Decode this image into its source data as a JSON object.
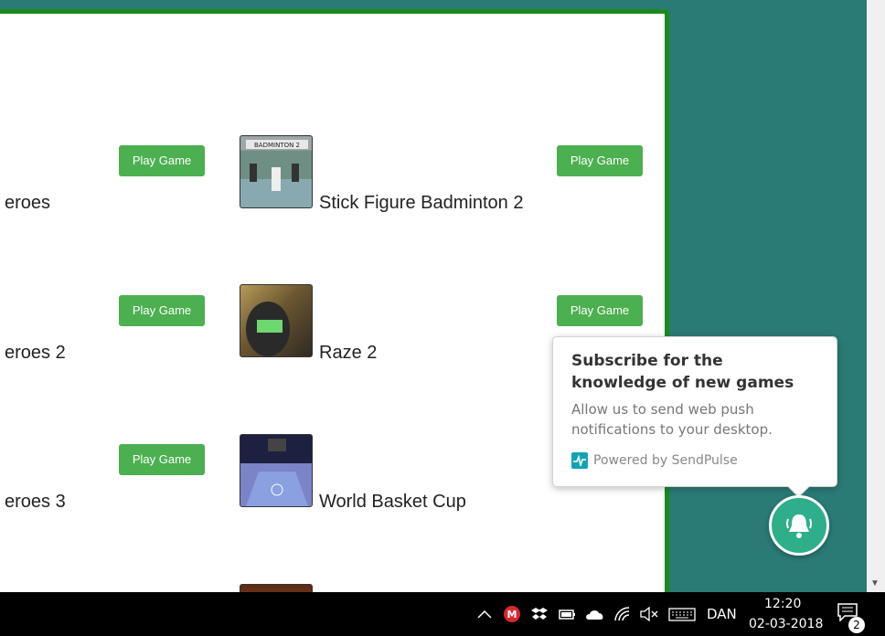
{
  "games": [
    {
      "left_name": "eroes",
      "left_button": "Play Game",
      "name": "Stick Figure Badminton 2",
      "button": "Play Game"
    },
    {
      "left_name": "eroes 2",
      "left_button": "Play Game",
      "name": "Raze 2",
      "button": "Play Game"
    },
    {
      "left_name": "eroes 3",
      "left_button": "Play Game",
      "name": "World Basket Cup",
      "button": "Play Game"
    }
  ],
  "popup": {
    "title": "Subscribe for the knowledge of new games",
    "body": "Allow us to send web push notifications to your desktop.",
    "powered_by": "Powered by SendPulse"
  },
  "taskbar": {
    "language": "DAN",
    "time": "12:20",
    "date": "02-03-2018",
    "notification_count": "2"
  },
  "colors": {
    "page_background": "#2a7a76",
    "panel_border": "#1b8a1b",
    "play_button": "#4caf50",
    "bell_button": "#2eae8a",
    "brand": "#13a4b4"
  },
  "icons": [
    "thumbnail-image",
    "bell-icon",
    "sendpulse-logo-icon",
    "chevron-up-icon",
    "mega-icon",
    "dropbox-icon",
    "battery-icon",
    "onedrive-icon",
    "wifi-icon",
    "volume-muted-icon",
    "keyboard-icon",
    "notification-icon"
  ]
}
